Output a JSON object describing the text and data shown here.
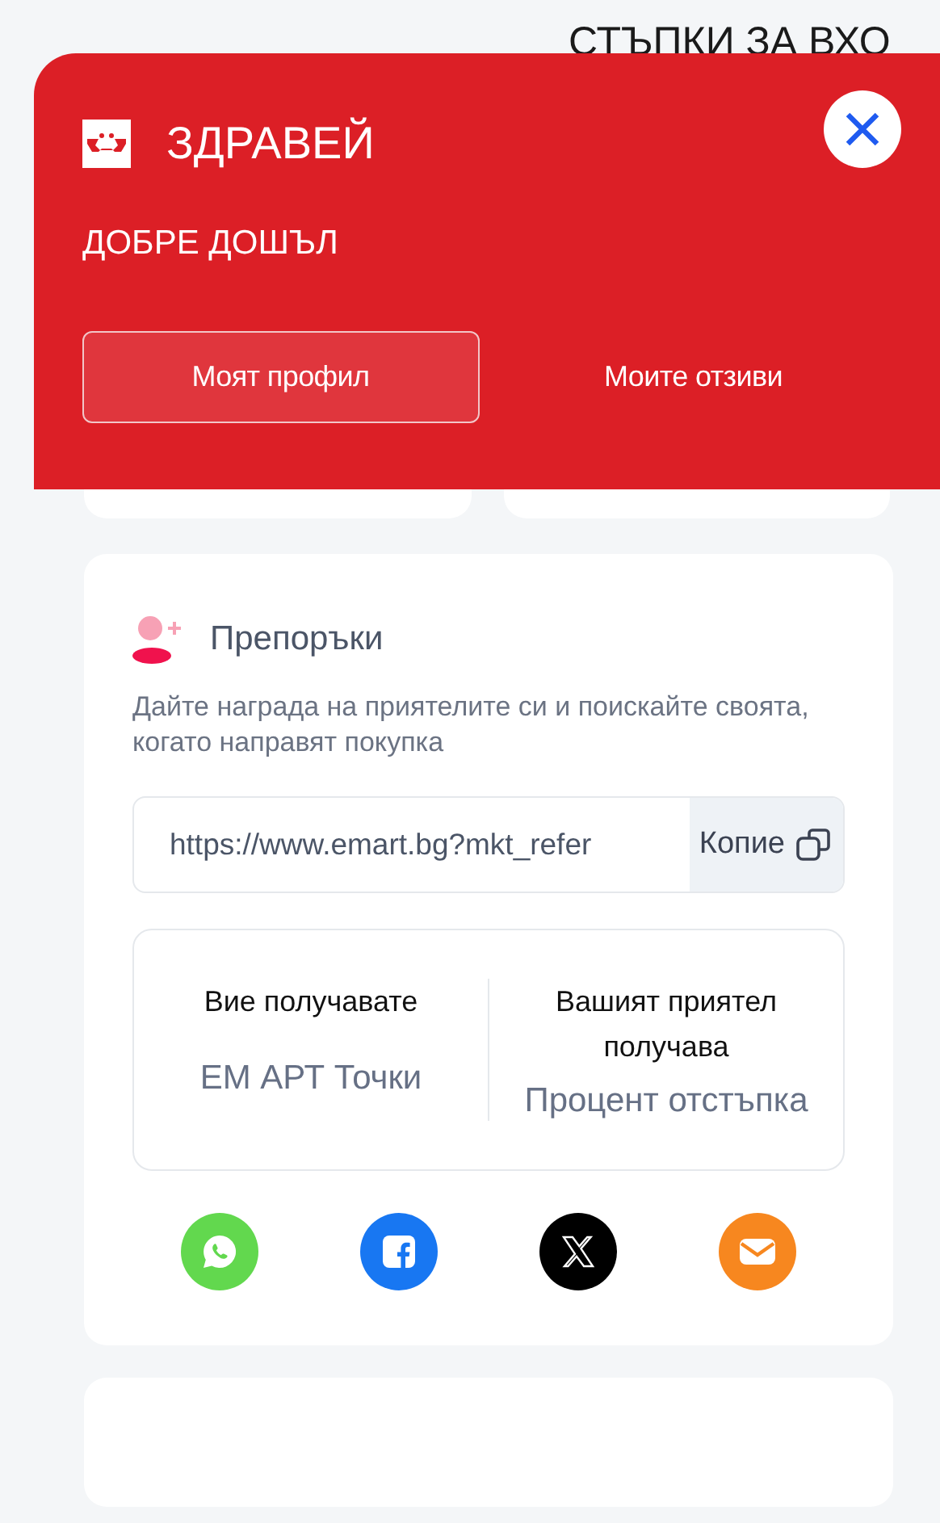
{
  "background_heading": "СТЪПКИ ЗА ВХО",
  "drawer": {
    "greeting": "ЗДРАВЕЙ",
    "subtitle": "ДОБРЕ ДОШЪЛ",
    "tabs": [
      {
        "label": "Моят профил",
        "selected": true
      },
      {
        "label": "Моите отзиви",
        "selected": false
      }
    ]
  },
  "referrals": {
    "title": "Препоръки",
    "description": "Дайте награда на приятелите си и поискайте своята, когато направят покупка",
    "link": "https://www.emart.bg?mkt_refer",
    "copy_button": "Копие",
    "rewards": [
      {
        "heading": "Вие получавате",
        "value": "ЕМ АРТ Точки"
      },
      {
        "heading": "Вашият приятел получава",
        "value": "Процент отстъпка"
      }
    ],
    "share": [
      {
        "kind": "whatsapp",
        "color": "#62d84e"
      },
      {
        "kind": "facebook",
        "color": "#1877f2"
      },
      {
        "kind": "x",
        "color": "#000000"
      },
      {
        "kind": "email",
        "color": "#f7871f"
      }
    ]
  }
}
